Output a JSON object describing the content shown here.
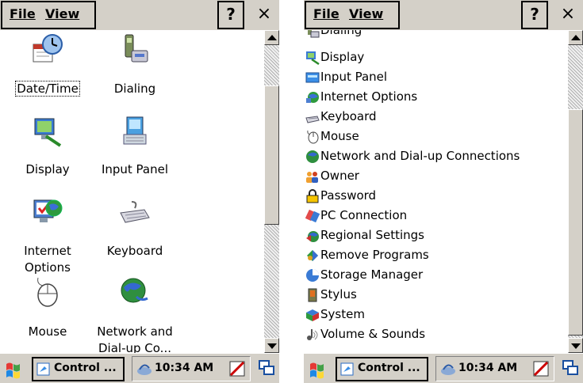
{
  "menu": {
    "file": "File",
    "view": "View",
    "help": "?",
    "close": "×"
  },
  "left": {
    "items": [
      {
        "label": "Date/Time",
        "icon": "date-time-icon"
      },
      {
        "label": "Dialing",
        "icon": "dialing-icon"
      },
      {
        "label": "Display",
        "icon": "display-icon"
      },
      {
        "label": "Input Panel",
        "icon": "input-panel-icon"
      },
      {
        "label": "Internet\nOptions",
        "icon": "internet-options-icon"
      },
      {
        "label": "Keyboard",
        "icon": "keyboard-icon"
      },
      {
        "label": "Mouse",
        "icon": "mouse-icon"
      },
      {
        "label": "Network and\nDial-up Co...",
        "icon": "network-icon"
      }
    ]
  },
  "right": {
    "items": [
      {
        "label": "Dialing",
        "icon": "dialing-icon"
      },
      {
        "label": "Display",
        "icon": "display-icon"
      },
      {
        "label": "Input Panel",
        "icon": "input-panel-icon"
      },
      {
        "label": "Internet Options",
        "icon": "internet-options-icon"
      },
      {
        "label": "Keyboard",
        "icon": "keyboard-icon"
      },
      {
        "label": "Mouse",
        "icon": "mouse-icon"
      },
      {
        "label": "Network and Dial-up Connections",
        "icon": "network-icon"
      },
      {
        "label": "Owner",
        "icon": "owner-icon"
      },
      {
        "label": "Password",
        "icon": "password-lock-icon"
      },
      {
        "label": "PC Connection",
        "icon": "pc-connection-icon"
      },
      {
        "label": "Regional Settings",
        "icon": "regional-settings-icon"
      },
      {
        "label": "Remove Programs",
        "icon": "remove-programs-icon"
      },
      {
        "label": "Storage Manager",
        "icon": "storage-manager-icon"
      },
      {
        "label": "Stylus",
        "icon": "stylus-icon"
      },
      {
        "label": "System",
        "icon": "system-icon"
      },
      {
        "label": "Volume & Sounds",
        "icon": "volume-sounds-icon"
      }
    ]
  },
  "taskbar": {
    "task_label": "Control ...",
    "time": "10:34 AM"
  }
}
